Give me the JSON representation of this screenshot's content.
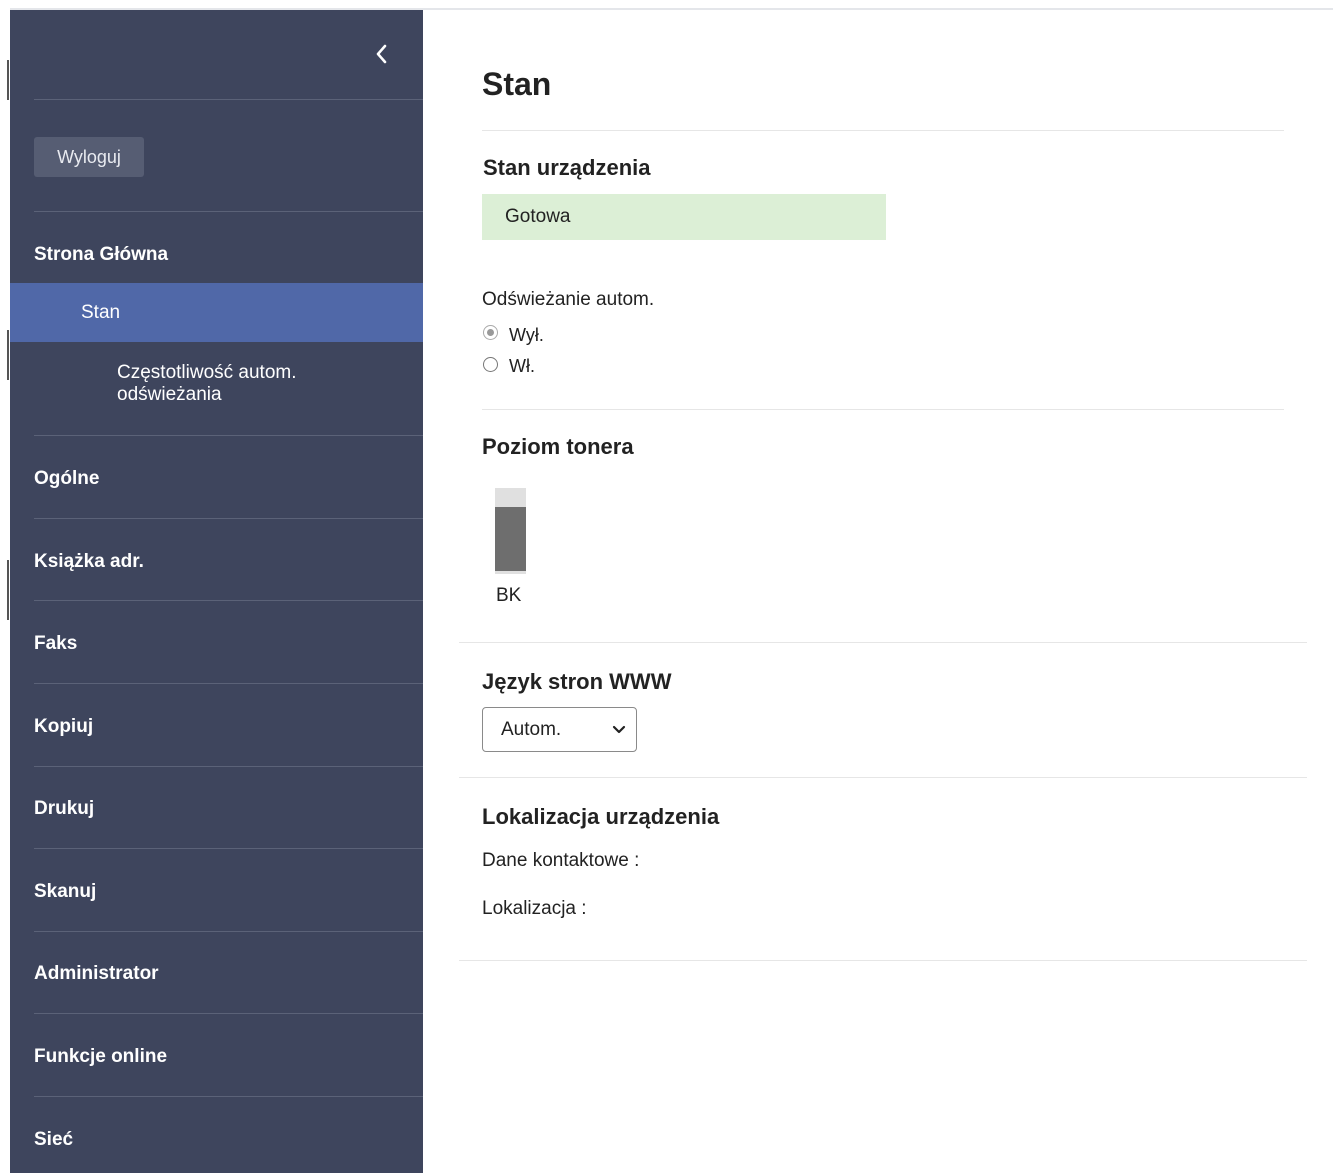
{
  "sidebar": {
    "logout_label": "Wyloguj",
    "home": {
      "label": "Strona Główna",
      "active_sub": "Stan",
      "subsub_line1": "Częstotliwość autom.",
      "subsub_line2": "odświeżania"
    },
    "items": [
      "Ogólne",
      "Książka adr.",
      "Faks",
      "Kopiuj",
      "Drukuj",
      "Skanuj",
      "Administrator",
      "Funkcje online",
      "Sieć"
    ]
  },
  "main": {
    "page_title": "Stan",
    "device_status": {
      "title": "Stan urządzenia",
      "value": "Gotowa",
      "color": "#dcefd6"
    },
    "auto_refresh": {
      "label": "Odświeżanie autom.",
      "options": [
        "Wył.",
        "Wł."
      ],
      "selected": "Wył."
    },
    "toner": {
      "title": "Poziom tonera",
      "label": "BK",
      "level_percent": 80
    },
    "language": {
      "title": "Język stron WWW",
      "selected": "Autom."
    },
    "location": {
      "title": "Lokalizacja urządzenia",
      "contact_label": "Dane kontaktowe :",
      "location_label": "Lokalizacja :"
    }
  },
  "colors": {
    "sidebar_bg": "#3e455d",
    "active_item_bg": "#5068a8",
    "status_ok_bg": "#dcefd6"
  },
  "icons": {
    "collapse": "chevron-left-icon",
    "select": "chevron-down-icon"
  }
}
